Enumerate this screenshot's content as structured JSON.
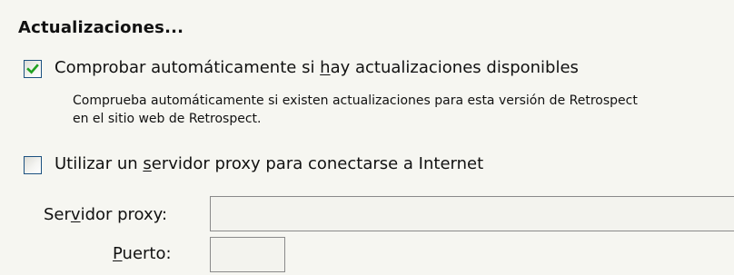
{
  "section": {
    "title": "Actualizaciones..."
  },
  "auto_check": {
    "checked": true,
    "label_before": "Comprobar automáticamente si ",
    "label_mnemonic": "h",
    "label_after": "ay actualizaciones disponibles",
    "description_line1": "Comprueba automáticamente si existen actualizaciones para esta versión de Retrospect",
    "description_line2": "en el sitio web de Retrospect."
  },
  "use_proxy": {
    "checked": false,
    "label_before": "Utilizar un ",
    "label_mnemonic": "s",
    "label_after": "ervidor proxy para conectarse a Internet"
  },
  "proxy_server": {
    "label_before": "Ser",
    "label_mnemonic": "v",
    "label_after": "idor proxy:",
    "value": ""
  },
  "proxy_port": {
    "label_before": "",
    "label_mnemonic": "P",
    "label_after": "uerto:",
    "value": ""
  },
  "colors": {
    "checkmark": "#21a121",
    "checkbox_border": "#1c5180",
    "background": "#f6f6f1"
  },
  "icons": {
    "checked": "checkmark-icon"
  }
}
